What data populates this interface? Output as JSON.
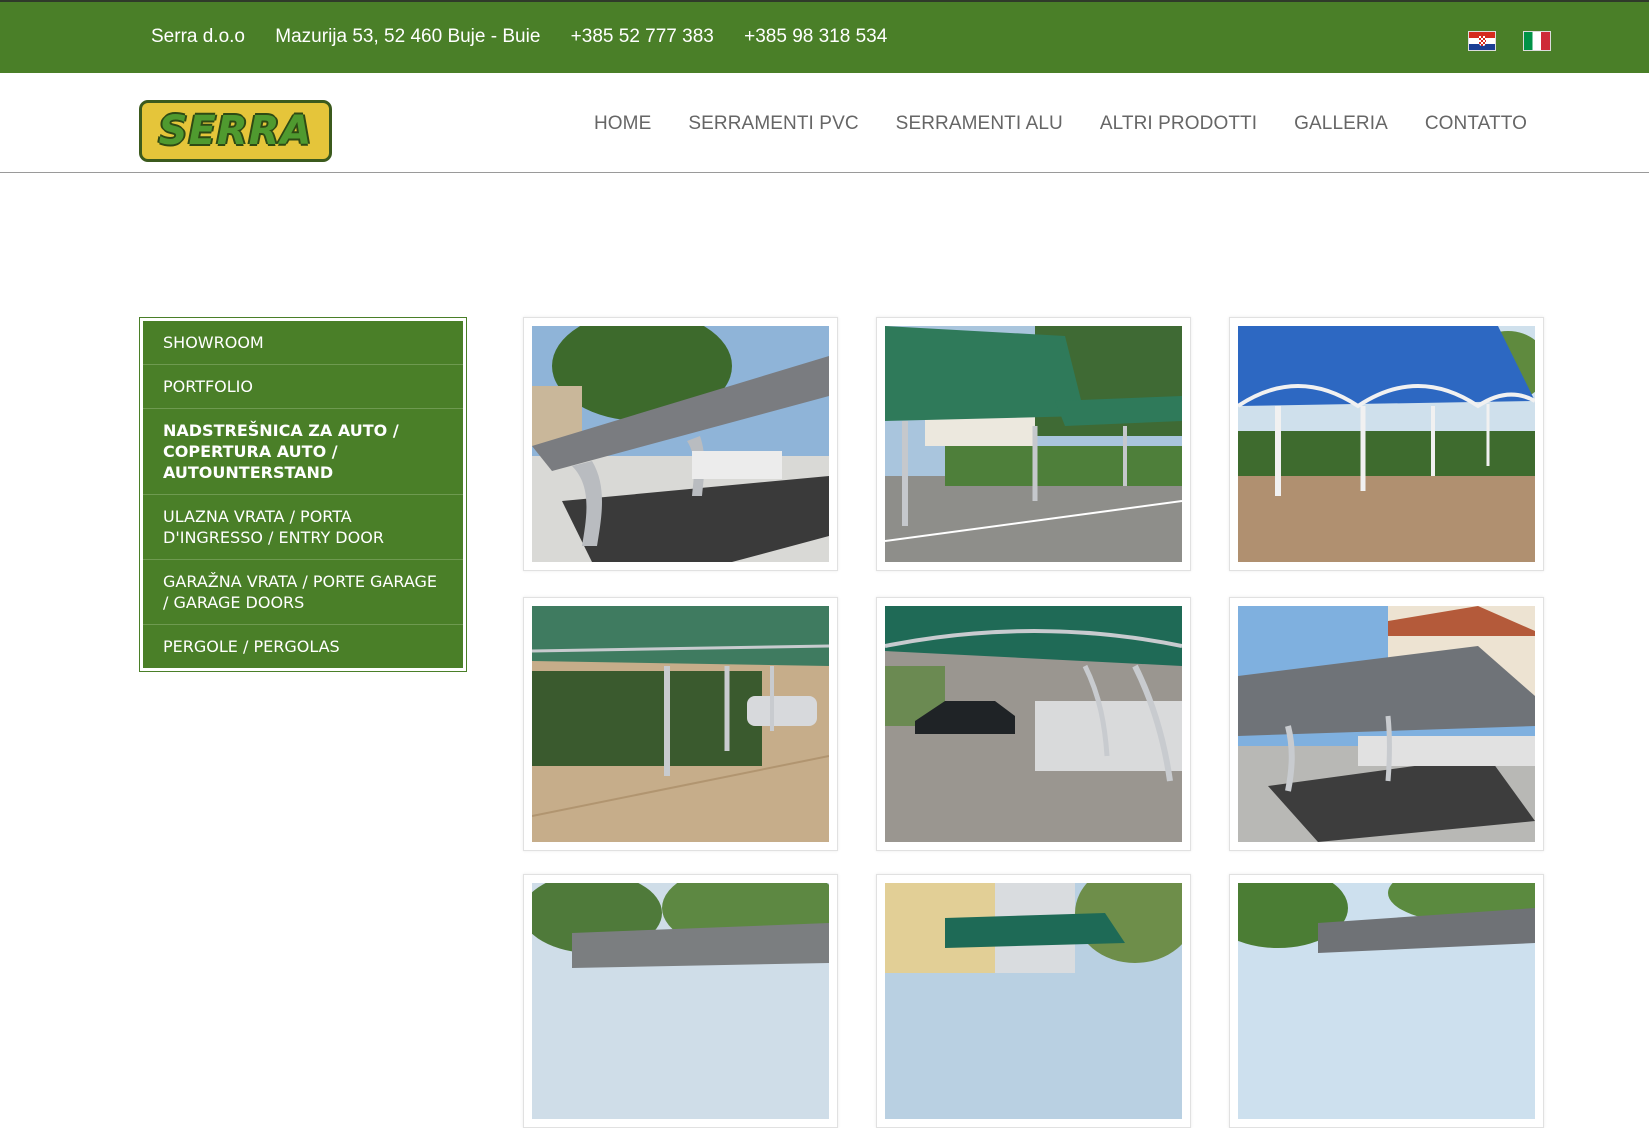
{
  "topbar": {
    "company": "Serra d.o.o",
    "address": "Mazurija 53, 52 460 Buje - Buie",
    "phone1": "+385 52 777 383",
    "phone2": "+385 98 318 534",
    "flags": [
      "croatian-flag-icon",
      "italian-flag-icon"
    ]
  },
  "header": {
    "logo_text": "SERRA",
    "nav": [
      "HOME",
      "SERRAMENTI PVC",
      "SERRAMENTI ALU",
      "ALTRI PRODOTTI",
      "GALLERIA",
      "CONTATTO"
    ]
  },
  "sidebar": {
    "items": [
      {
        "label": "SHOWROOM"
      },
      {
        "label": "PORTFOLIO"
      },
      {
        "label": "NADSTREŠNICA ZA AUTO / COPERTURA AUTO / AUTOUNTERSTAND"
      },
      {
        "label": "ULAZNA VRATA / PORTA D'INGRESSO / ENTRY DOOR"
      },
      {
        "label": "GARAŽNA VRATA / PORTE GARAGE / GARAGE DOORS"
      },
      {
        "label": "PERGOLE / PERGOLAS"
      }
    ]
  },
  "colors": {
    "brand_green": "#4a7f28",
    "logo_yellow": "#e5c53a",
    "nav_text": "#666666"
  }
}
